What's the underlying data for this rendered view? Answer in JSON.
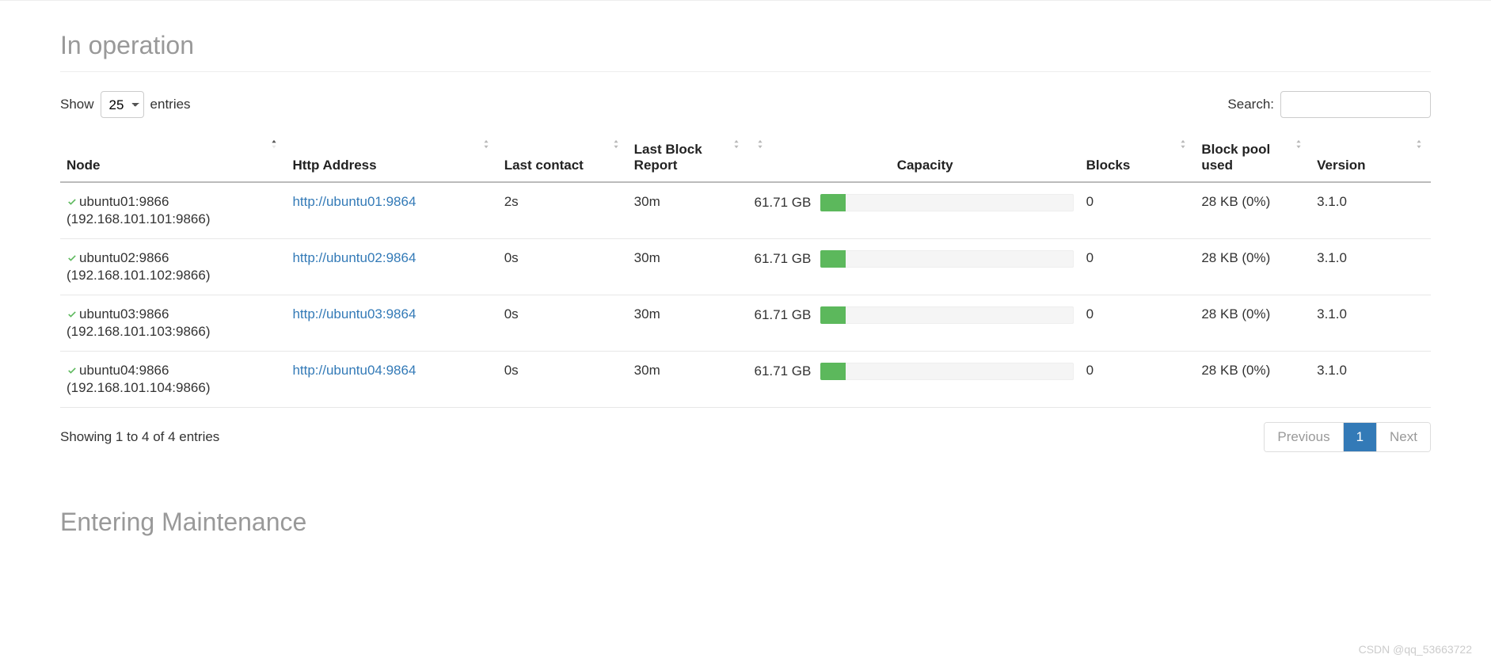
{
  "sections": {
    "in_operation": "In operation",
    "entering_maintenance": "Entering Maintenance"
  },
  "controls": {
    "show_label": "Show",
    "entries_label": "entries",
    "entries_value": "25",
    "search_label": "Search:",
    "search_value": ""
  },
  "columns": {
    "node": "Node",
    "http_address": "Http Address",
    "last_contact": "Last contact",
    "last_block_report": "Last Block Report",
    "capacity": "Capacity",
    "blocks": "Blocks",
    "block_pool_used": "Block pool used",
    "version": "Version"
  },
  "rows": [
    {
      "node_name": "ubuntu01:9866",
      "node_addr": "(192.168.101.101:9866)",
      "http": "http://ubuntu01:9864",
      "last_contact": "2s",
      "last_block_report": "30m",
      "capacity_text": "61.71 GB",
      "capacity_fill_pct": 10,
      "blocks": "0",
      "block_pool_used": "28 KB (0%)",
      "version": "3.1.0"
    },
    {
      "node_name": "ubuntu02:9866",
      "node_addr": "(192.168.101.102:9866)",
      "http": "http://ubuntu02:9864",
      "last_contact": "0s",
      "last_block_report": "30m",
      "capacity_text": "61.71 GB",
      "capacity_fill_pct": 10,
      "blocks": "0",
      "block_pool_used": "28 KB (0%)",
      "version": "3.1.0"
    },
    {
      "node_name": "ubuntu03:9866",
      "node_addr": "(192.168.101.103:9866)",
      "http": "http://ubuntu03:9864",
      "last_contact": "0s",
      "last_block_report": "30m",
      "capacity_text": "61.71 GB",
      "capacity_fill_pct": 10,
      "blocks": "0",
      "block_pool_used": "28 KB (0%)",
      "version": "3.1.0"
    },
    {
      "node_name": "ubuntu04:9866",
      "node_addr": "(192.168.101.104:9866)",
      "http": "http://ubuntu04:9864",
      "last_contact": "0s",
      "last_block_report": "30m",
      "capacity_text": "61.71 GB",
      "capacity_fill_pct": 10,
      "blocks": "0",
      "block_pool_used": "28 KB (0%)",
      "version": "3.1.0"
    }
  ],
  "footer": {
    "info": "Showing 1 to 4 of 4 entries",
    "prev": "Previous",
    "page": "1",
    "next": "Next"
  },
  "watermark": "CSDN @qq_53663722"
}
